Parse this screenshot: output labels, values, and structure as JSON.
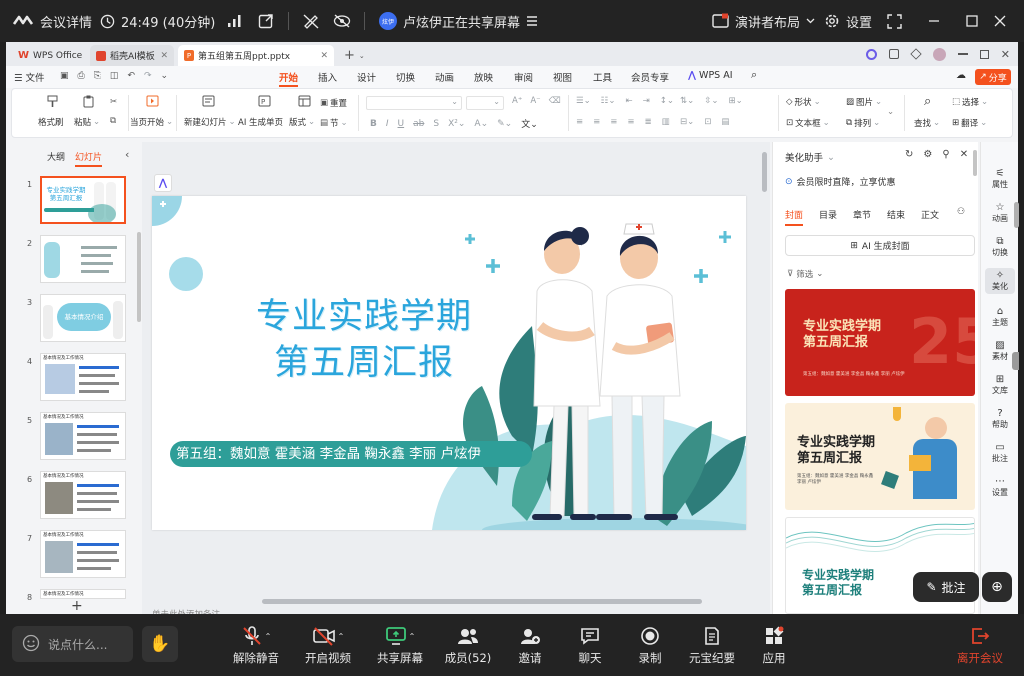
{
  "meeting": {
    "details_label": "会议详情",
    "timer": "24:49 (40分钟)",
    "sharing_status": "卢炫伊正在共享屏幕",
    "sharer_avatar_text": "炫伊",
    "layout_label": "演讲者布局",
    "settings_label": "设置",
    "chat_placeholder": "说点什么...",
    "toolbar": {
      "unmute": "解除静音",
      "video": "开启视频",
      "share": "共享屏幕",
      "members": "成员(52)",
      "invite": "邀请",
      "chat": "聊天",
      "record": "录制",
      "yuanbao": "元宝纪要",
      "apps": "应用",
      "leave": "离开会议"
    },
    "annotate_label": "批注"
  },
  "wps": {
    "tabs": [
      "WPS Office",
      "稻壳AI模板",
      "第五组第五周ppt.pptx"
    ],
    "file_menu": "文件",
    "menus": [
      "开始",
      "插入",
      "设计",
      "切换",
      "动画",
      "放映",
      "审阅",
      "视图",
      "工具",
      "会员专享",
      "WPS AI"
    ],
    "active_menu": "开始",
    "share_button": "分享",
    "ribbon": {
      "format_painter": "格式刷",
      "paste": "粘贴",
      "play_current": "当页开始",
      "new_slide": "新建幻灯片",
      "ai_single": "AI 生成单页",
      "layout": "版式",
      "section": "节",
      "reset": "重置",
      "shape": "形状",
      "picture": "图片",
      "textbox": "文本框",
      "arrange": "排列",
      "find": "查找",
      "select": "选择",
      "translate": "翻译"
    },
    "left_tabs": [
      "大纲",
      "幻灯片"
    ],
    "active_left_tab": "幻灯片",
    "slide_numbers": [
      "1",
      "2",
      "3",
      "4",
      "5",
      "6",
      "7",
      "8"
    ],
    "thumb_texts": {
      "t1": "专业实践学期\n第五周汇报",
      "t3": "基本情况介绍",
      "t_header": "基本情况及工作情况"
    },
    "slide": {
      "title_line1": "专业实践学期",
      "title_line2": "第五周汇报",
      "members": "第五组：魏如意  霍美涵  李金晶  鞠永鑫  李丽  卢炫伊"
    },
    "status_text": "单击此处添加备注",
    "beauty": {
      "title": "美化助手",
      "promo": "会员限时直降，立享优惠",
      "tabs": [
        "封面",
        "目录",
        "章节",
        "结束",
        "正文"
      ],
      "active_tab": "封面",
      "ai_cover_button": "AI 生成封面",
      "filter": "筛选",
      "card1_title": "专业实践学期\n第五周汇报",
      "card2_title": "专业实践学期\n第五周汇报",
      "card3_title": "专业实践学期\n第五周汇报",
      "card_names": "第五组：魏如意 霍美涵 李金晶 鞠永鑫 李丽 卢炫伊"
    },
    "sidebar": [
      "属性",
      "动画",
      "切换",
      "美化",
      "主题",
      "素材",
      "文库",
      "帮助",
      "批注",
      "设置"
    ],
    "active_sidebar": "美化"
  },
  "colors": {
    "accent_orange": "#f4511e",
    "teal": "#2e9e98",
    "slide_title_blue": "#2aa5dc",
    "leave_red": "#e0442d"
  }
}
